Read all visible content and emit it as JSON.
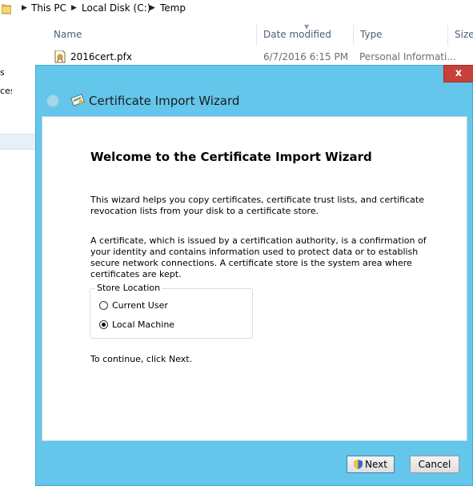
{
  "explorer": {
    "breadcrumb": [
      "This PC",
      "Local Disk (C:)",
      "Temp"
    ],
    "columns": {
      "name": "Name",
      "date_modified": "Date modified",
      "type": "Type",
      "size": "Size"
    },
    "file": {
      "name": "2016cert.pfx",
      "date_modified": "6/7/2016 6:15 PM",
      "type": "Personal Informati..."
    },
    "nav_fragments": [
      "s",
      "ces"
    ]
  },
  "wizard": {
    "title": "Certificate Import Wizard",
    "close_glyph": "x",
    "heading": "Welcome to the Certificate Import Wizard",
    "intro": "This wizard helps you copy certificates, certificate trust lists, and certificate revocation lists from your disk to a certificate store.",
    "description": "A certificate, which is issued by a certification authority, is a confirmation of your identity and contains information used to protect data or to establish secure network connections. A certificate store is the system area where certificates are kept.",
    "store_location": {
      "label": "Store Location",
      "options": [
        {
          "label": "Current User",
          "selected": false
        },
        {
          "label": "Local Machine",
          "selected": true
        }
      ]
    },
    "continue_text": "To continue, click Next.",
    "buttons": {
      "next": "Next",
      "cancel": "Cancel"
    }
  },
  "colors": {
    "dialog_frame": "#63c6ea",
    "close_button": "#c7403a",
    "header_text": "#4c607a"
  }
}
